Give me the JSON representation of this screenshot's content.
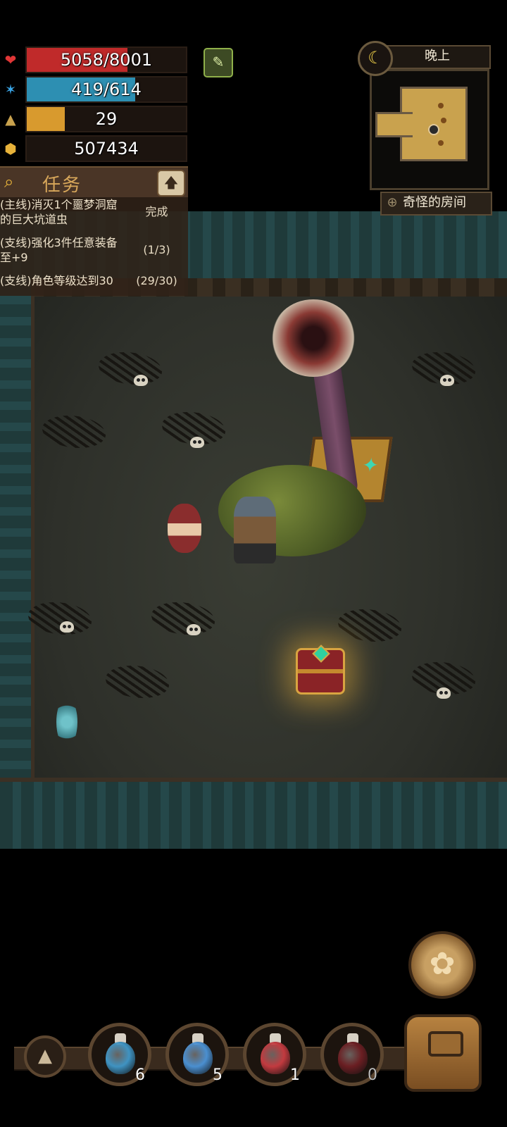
{
  "stats": {
    "hp": {
      "text": "5058/8001",
      "fraction": 0.632,
      "color": "#c02a2a"
    },
    "mp": {
      "text": "419/614",
      "fraction": 0.682,
      "color": "#2d8fb2"
    },
    "level": {
      "text": "29",
      "fraction": 0.24,
      "color": "#d89a2e"
    },
    "gold": {
      "text": "507434"
    }
  },
  "quests": {
    "title": "任务",
    "items": [
      {
        "text": "(主线)消灭1个噩梦洞窟的巨大坑道虫",
        "status": "完成"
      },
      {
        "text": "(支线)强化3件任意装备至+9",
        "status": "(1/3)"
      },
      {
        "text": "(支线)角色等级达到30",
        "status": "(29/30)"
      }
    ]
  },
  "minimap": {
    "time_of_day": "晚上",
    "room_name": "奇怪的房间"
  },
  "potions": [
    {
      "name": "small-blue-potion",
      "count": "6",
      "color": "#3f93c2"
    },
    {
      "name": "large-blue-potion",
      "count": "5",
      "color": "#4a8fd0"
    },
    {
      "name": "red-potion",
      "count": "1",
      "color": "#c23a3f"
    },
    {
      "name": "dark-red-potion",
      "count": "0",
      "color": "#6a1e22"
    }
  ],
  "icons": {
    "hp": "heart-icon",
    "mp": "mana-icon",
    "level": "triangle-icon",
    "gold": "gold-icon",
    "time": "moon-icon"
  }
}
